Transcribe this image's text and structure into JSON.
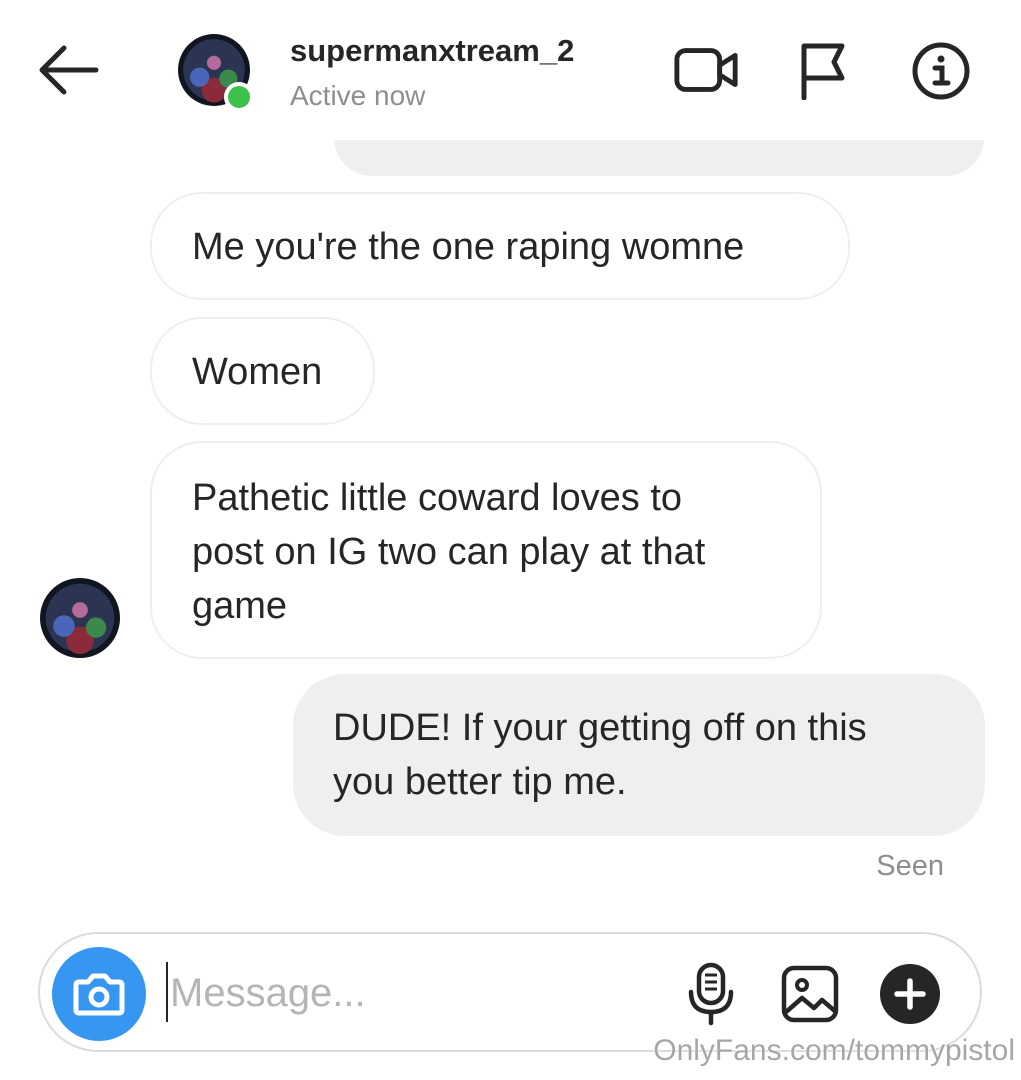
{
  "header": {
    "username": "supermanxtream_2",
    "status": "Active now",
    "icons": {
      "back": "arrow-left-icon",
      "video": "video-camera-icon",
      "report": "flag-icon",
      "info": "info-icon"
    },
    "online_color": "#3cc24a"
  },
  "messages": [
    {
      "from": "them",
      "text": "Me you're the one raping womne"
    },
    {
      "from": "them",
      "text": "Women"
    },
    {
      "from": "them",
      "lines": [
        "Pathetic little coward loves to",
        "post on IG two can play at that",
        "game"
      ]
    },
    {
      "from": "me",
      "lines": [
        "DUDE! If your getting off on this",
        "you better tip me."
      ]
    }
  ],
  "seen_label": "Seen",
  "composer": {
    "placeholder": "Message...",
    "icons": [
      "camera-icon",
      "microphone-icon",
      "gallery-icon",
      "add-icon"
    ],
    "camera_color": "#3797f0"
  },
  "watermark": "OnlyFans.com/tommypistol"
}
